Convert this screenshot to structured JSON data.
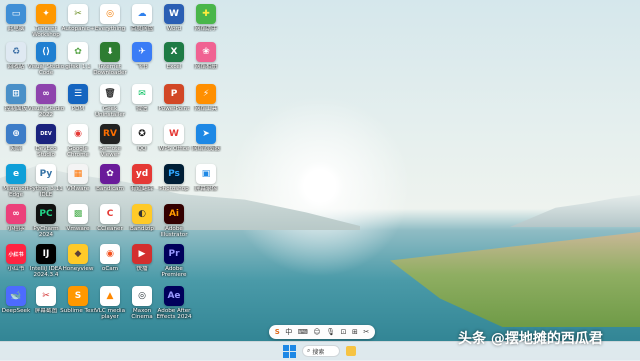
{
  "desktop": {
    "icons": [
      {
        "label": "此电脑",
        "icon": "computer-icon",
        "glyph": "▭",
        "bg": "#3f8fd6",
        "fg": "#fff"
      },
      {
        "label": "Tencent Workshop",
        "icon": "tencent-icon",
        "glyph": "✦",
        "bg": "#ff9800",
        "fg": "#fff"
      },
      {
        "label": "Autopanic+",
        "icon": "autopanic-icon",
        "glyph": "✂",
        "bg": "#ffffff",
        "fg": "#6b8e23"
      },
      {
        "label": "Everything",
        "icon": "everything-icon",
        "glyph": "◎",
        "bg": "#ffffff",
        "fg": "#f57c00"
      },
      {
        "label": "百度网盘",
        "icon": "baidu-netdisk-icon",
        "glyph": "☁",
        "bg": "#ffffff",
        "fg": "#2f80ed"
      },
      {
        "label": "Word",
        "icon": "word-icon",
        "glyph": "W",
        "bg": "#2b5fb4",
        "fg": "#fff"
      },
      {
        "label": "网络助手",
        "icon": "network-assistant-icon",
        "glyph": "✚",
        "bg": "#49b64a",
        "fg": "#ffec3d"
      },
      {
        "label": "回收站",
        "icon": "recycle-bin-icon",
        "glyph": "♻",
        "bg": "#dfe9f2",
        "fg": "#3a6ea5"
      },
      {
        "label": "Visual Studio Code",
        "icon": "vscode-icon",
        "glyph": "⟨⟩",
        "bg": "#1f7fd1",
        "fg": "#fff"
      },
      {
        "label": "gifski 1.1",
        "icon": "gifski-icon",
        "glyph": "✿",
        "bg": "#ffffff",
        "fg": "#5aa64a"
      },
      {
        "label": "Internet Downloader",
        "icon": "downloader-icon",
        "glyph": "⬇",
        "bg": "#2e7d32",
        "fg": "#fff"
      },
      {
        "label": "飞书",
        "icon": "feishu-icon",
        "glyph": "✈",
        "bg": "#3a7cf6",
        "fg": "#fff"
      },
      {
        "label": "Excel",
        "icon": "excel-icon",
        "glyph": "X",
        "bg": "#1e7b45",
        "fg": "#fff"
      },
      {
        "label": "网络相册",
        "icon": "photo-album-icon",
        "glyph": "❀",
        "bg": "#f06292",
        "fg": "#fff"
      },
      {
        "label": "控制面板",
        "icon": "control-panel-icon",
        "glyph": "⊞",
        "bg": "#4a90c8",
        "fg": "#fff"
      },
      {
        "label": "Visual Studio 2022",
        "icon": "visual-studio-icon",
        "glyph": "∞",
        "bg": "#8e44ad",
        "fg": "#fff"
      },
      {
        "label": "PDM",
        "icon": "pdm-icon",
        "glyph": "☰",
        "bg": "#1565c0",
        "fg": "#fff"
      },
      {
        "label": "Geek Uninstaller",
        "icon": "geek-uninstaller-icon",
        "glyph": "🗑",
        "bg": "#ffffff",
        "fg": "#333"
      },
      {
        "label": "微信",
        "icon": "wechat-icon",
        "glyph": "✉",
        "bg": "#ffffff",
        "fg": "#07c160"
      },
      {
        "label": "PowerPoint",
        "icon": "powerpoint-icon",
        "glyph": "P",
        "bg": "#d24726",
        "fg": "#fff"
      },
      {
        "label": "网络工具",
        "icon": "network-tool-icon",
        "glyph": "⚡",
        "bg": "#ff8f00",
        "fg": "#fff"
      },
      {
        "label": "网络",
        "icon": "network-icon",
        "glyph": "⊕",
        "bg": "#3d7dc8",
        "fg": "#fff"
      },
      {
        "label": "DevEco Studio",
        "icon": "deveco-icon",
        "glyph": "DEV",
        "bg": "#1a237e",
        "fg": "#fff"
      },
      {
        "label": "Google Chrome",
        "icon": "chrome-icon",
        "glyph": "◉",
        "bg": "#ffffff",
        "fg": "#e53935"
      },
      {
        "label": "Remote Viewer",
        "icon": "remote-viewer-icon",
        "glyph": "RV",
        "bg": "#222222",
        "fg": "#ff6f00"
      },
      {
        "label": "QQ",
        "icon": "qq-icon",
        "glyph": "✪",
        "bg": "#ffffff",
        "fg": "#111"
      },
      {
        "label": "WPS Office",
        "icon": "wps-icon",
        "glyph": "W",
        "bg": "#ffffff",
        "fg": "#e53935"
      },
      {
        "label": "网络浏览器",
        "icon": "browser-icon",
        "glyph": "➤",
        "bg": "#1e88e5",
        "fg": "#fff"
      },
      {
        "label": "Microsoft Edge",
        "icon": "edge-icon",
        "glyph": "e",
        "bg": "#0f9fd8",
        "fg": "#fff"
      },
      {
        "label": "Python 3.11 IDLE",
        "icon": "python-icon",
        "glyph": "Py",
        "bg": "#ffffff",
        "fg": "#3572a5"
      },
      {
        "label": "VMware",
        "icon": "vmware-icon",
        "glyph": "▦",
        "bg": "#f4f4f4",
        "fg": "#ff7300"
      },
      {
        "label": "Bandicam",
        "icon": "bandicam-icon",
        "glyph": "✿",
        "bg": "#6a1b9a",
        "fg": "#fff"
      },
      {
        "label": "有道翻译",
        "icon": "youdao-icon",
        "glyph": "yd",
        "bg": "#e53935",
        "fg": "#fff"
      },
      {
        "label": "Photoshop",
        "icon": "photoshop-icon",
        "glyph": "Ps",
        "bg": "#001e36",
        "fg": "#31a8ff"
      },
      {
        "label": "屏幕录像",
        "icon": "screen-recorder-icon",
        "glyph": "▣",
        "bg": "#ffffff",
        "fg": "#1e88e5"
      },
      {
        "label": "小程序",
        "icon": "miniprogram-icon",
        "glyph": "∞",
        "bg": "#ec407a",
        "fg": "#fff"
      },
      {
        "label": "PyCharm 2024",
        "icon": "pycharm-icon",
        "glyph": "PC",
        "bg": "#111111",
        "fg": "#21d789"
      },
      {
        "label": "Vmware",
        "icon": "vmware-grid-icon",
        "glyph": "▩",
        "bg": "#ffffff",
        "fg": "#4caf50"
      },
      {
        "label": "CCleaner",
        "icon": "ccleaner-icon",
        "glyph": "C",
        "bg": "#ffffff",
        "fg": "#e53935"
      },
      {
        "label": "Bandizip",
        "icon": "bandizip-icon",
        "glyph": "◐",
        "bg": "#ffca28",
        "fg": "#333"
      },
      {
        "label": "Adobe Illustrator",
        "icon": "illustrator-icon",
        "glyph": "Ai",
        "bg": "#330000",
        "fg": "#ff9a00"
      },
      {
        "label": "",
        "icon": "",
        "glyph": "",
        "bg": "",
        "fg": ""
      },
      {
        "label": "小红书",
        "icon": "xiaohongshu-icon",
        "glyph": "小红书",
        "bg": "#ff2442",
        "fg": "#fff"
      },
      {
        "label": "IntelliJ IDEA 2024.3.4",
        "icon": "intellij-icon",
        "glyph": "IJ",
        "bg": "#000000",
        "fg": "#fff"
      },
      {
        "label": "Honeyview",
        "icon": "honeyview-icon",
        "glyph": "◆",
        "bg": "#ffca28",
        "fg": "#5d4037"
      },
      {
        "label": "oCam",
        "icon": "ocam-icon",
        "glyph": "◉",
        "bg": "#ffffff",
        "fg": "#f4511e"
      },
      {
        "label": "快播",
        "icon": "player-icon",
        "glyph": "▶",
        "bg": "#d32f2f",
        "fg": "#fff"
      },
      {
        "label": "Adobe Premiere",
        "icon": "premiere-icon",
        "glyph": "Pr",
        "bg": "#00005b",
        "fg": "#9999ff"
      },
      {
        "label": "",
        "icon": "",
        "glyph": "",
        "bg": "",
        "fg": ""
      },
      {
        "label": "DeepSeek",
        "icon": "deepseek-icon",
        "glyph": "🐋",
        "bg": "#4d6bfe",
        "fg": "#fff"
      },
      {
        "label": "屏幕截图",
        "icon": "screenshot-icon",
        "glyph": "✂",
        "bg": "#ffffff",
        "fg": "#d32f2f"
      },
      {
        "label": "Sublime Text",
        "icon": "sublime-icon",
        "glyph": "S",
        "bg": "#ff9800",
        "fg": "#fff"
      },
      {
        "label": "VLC media player",
        "icon": "vlc-icon",
        "glyph": "▲",
        "bg": "#ffffff",
        "fg": "#ff8800"
      },
      {
        "label": "Maxon Cinema",
        "icon": "cinema-icon",
        "glyph": "◎",
        "bg": "#ffffff",
        "fg": "#263238"
      },
      {
        "label": "Adobe After Effects 2024",
        "icon": "after-effects-icon",
        "glyph": "Ae",
        "bg": "#00005b",
        "fg": "#9999ff"
      }
    ]
  },
  "ime_toolbar": {
    "logo": "S",
    "mode": "中",
    "items": [
      "⌨",
      "☺",
      "🎙",
      "⊡",
      "⊞",
      "✂"
    ]
  },
  "taskbar": {
    "search_label": "搜索",
    "apps": [
      {
        "icon": "explorer-icon",
        "color": "#f6c343"
      }
    ]
  },
  "watermark": "头条 @摆地摊的西瓜君"
}
